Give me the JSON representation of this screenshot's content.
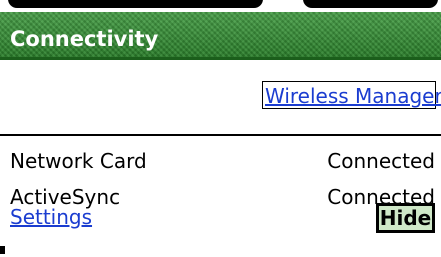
{
  "window": {
    "title": "Connectivity"
  },
  "header": {
    "wireless_manager_link": "Wireless Manager"
  },
  "connections": [
    {
      "name": "Network Card",
      "status": "Connected"
    },
    {
      "name": "ActiveSync",
      "status": "Connected"
    }
  ],
  "footer": {
    "settings_link": "Settings",
    "hide_button": "Hide"
  },
  "colors": {
    "title_bar": "#2f8a2f",
    "link": "#1a3cd0",
    "hide_button_bg": "#cfe8c8"
  }
}
